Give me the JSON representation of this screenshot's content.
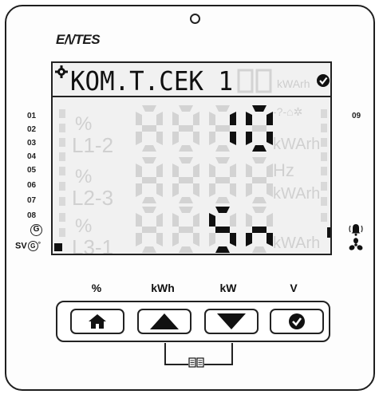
{
  "brand": {
    "logo_text": "E/\\/TES"
  },
  "lcd": {
    "menu_text": "KOM.T.CEK 1",
    "top_unit_label": "kWArh",
    "row1_value": "10",
    "row2_value": "",
    "row3_value": "Sn",
    "row1_unit": "kWArh",
    "row2_unit_top": "Hz",
    "row2_unit": "kWArh",
    "row3_unit": "kWArh",
    "phase_labels": [
      "L1-2",
      "L2-3",
      "L3-1"
    ],
    "percent_label": "%",
    "colors": {
      "lit": "#101010",
      "unlit": "#d3d3d3",
      "background": "#f1f1f1"
    }
  },
  "left_channels": [
    "01",
    "02",
    "03",
    "04",
    "05",
    "06",
    "07",
    "08"
  ],
  "left_indicators": {
    "g_label": "G",
    "sv_label": "SV"
  },
  "right_channel": "09",
  "right_icons": [
    "alarm-bell-icon",
    "fan-icon"
  ],
  "buttons": [
    {
      "label": "%",
      "icon": "home-icon"
    },
    {
      "label": "kWh",
      "icon": "up-arrow-icon"
    },
    {
      "label": "kW",
      "icon": "down-arrow-icon"
    },
    {
      "label": "V",
      "icon": "check-icon"
    }
  ],
  "bracket_icon": "book-icon"
}
